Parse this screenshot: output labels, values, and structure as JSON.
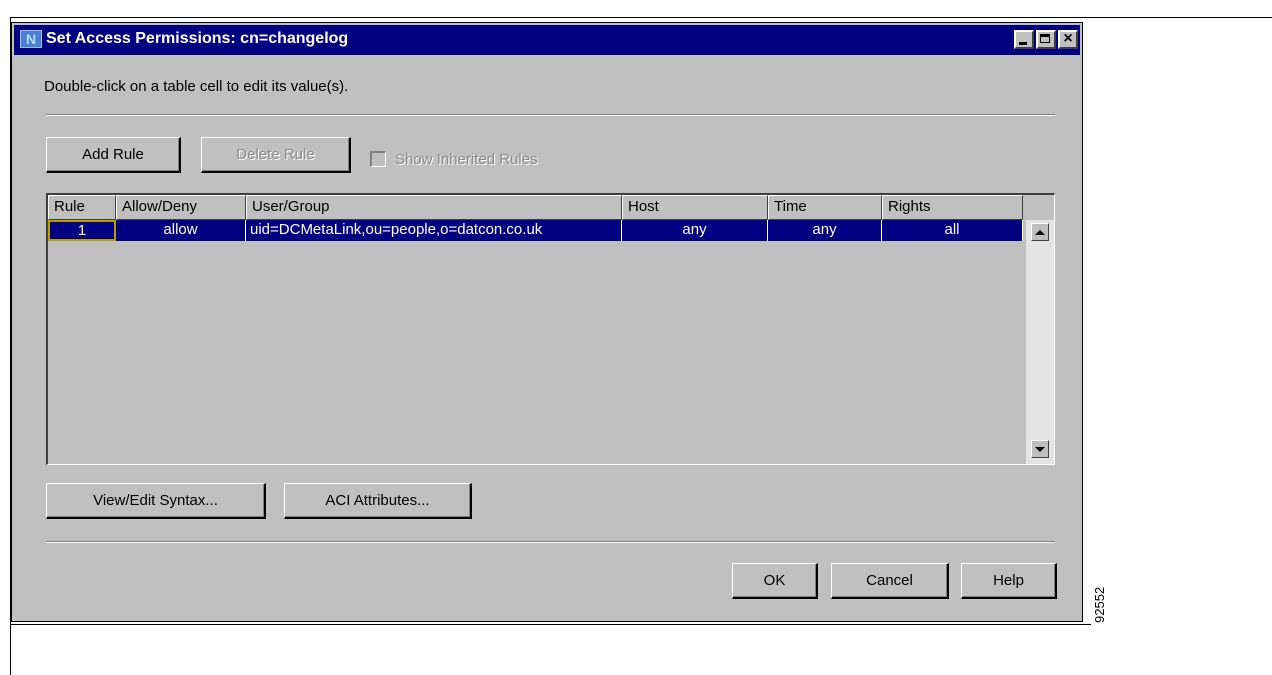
{
  "window": {
    "title": "Set Access Permissions: cn=changelog",
    "app_icon_letter": "N"
  },
  "instruction": "Double-click on a table cell to edit its value(s).",
  "toolbar": {
    "add_rule": "Add Rule",
    "delete_rule": "Delete Rule",
    "show_inherited": "Show Inherited Rules",
    "show_inherited_checked": false
  },
  "table": {
    "columns": [
      "Rule",
      "Allow/Deny",
      "User/Group",
      "Host",
      "Time",
      "Rights"
    ],
    "rows": [
      [
        "1",
        "allow",
        "uid=DCMetaLink,ou=people,o=datcon.co.uk",
        "any",
        "any",
        "all"
      ]
    ],
    "selected_row": 0
  },
  "bottom_buttons": {
    "view_edit_syntax": "View/Edit Syntax...",
    "aci_attributes": "ACI Attributes..."
  },
  "dialog_buttons": {
    "ok": "OK",
    "cancel": "Cancel",
    "help": "Help"
  },
  "figure_number": "92552",
  "colors": {
    "title_bar": "#000080",
    "dialog_bg": "#c0c0c0",
    "selection": "#000080"
  }
}
